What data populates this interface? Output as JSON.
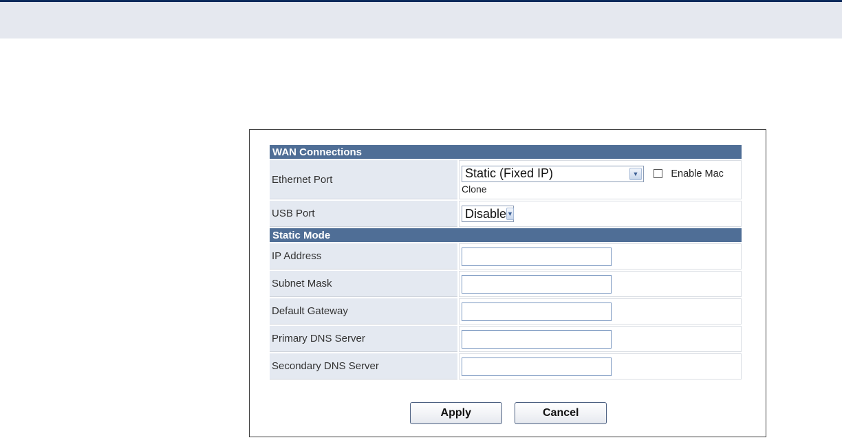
{
  "sections": {
    "wan_connections": "WAN Connections",
    "static_mode": "Static Mode"
  },
  "ethernet_port": {
    "label": "Ethernet Port",
    "selected": "Static (Fixed IP)",
    "mac_clone_label": "Enable Mac",
    "mac_clone_label_wrap": "Clone",
    "mac_clone_checked": false
  },
  "usb_port": {
    "label": "USB Port",
    "selected": "Disable"
  },
  "fields": {
    "ip_address": {
      "label": "IP Address",
      "value": ""
    },
    "subnet_mask": {
      "label": "Subnet Mask",
      "value": ""
    },
    "default_gateway": {
      "label": "Default Gateway",
      "value": ""
    },
    "primary_dns": {
      "label": "Primary DNS Server",
      "value": ""
    },
    "secondary_dns": {
      "label": "Secondary DNS Server",
      "value": ""
    }
  },
  "buttons": {
    "apply": "Apply",
    "cancel": "Cancel"
  },
  "icons": {
    "dropdown": "chevron-down-icon",
    "checkbox": "checkbox-icon"
  },
  "colors": {
    "header_band": "#4f6e96",
    "label_background": "#e4e9f1",
    "top_rule": "#0b2a5c",
    "top_band": "#e5e8ef"
  }
}
